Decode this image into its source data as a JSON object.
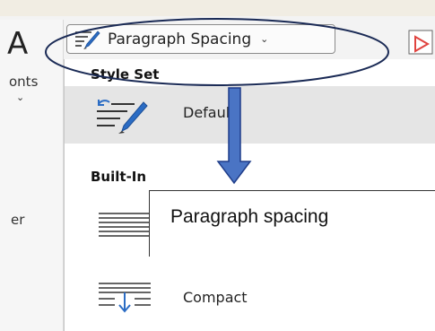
{
  "ribbon": {
    "fonts_label": "onts",
    "left_label": "er"
  },
  "paragraph_button": {
    "label": "Paragraph Spacing"
  },
  "dropdown": {
    "style_set_heading": "Style Set",
    "default_label": "Default",
    "builtin_heading": "Built-In",
    "compact_label": "Compact"
  },
  "callout": {
    "text": "Paragraph spacing"
  },
  "colors": {
    "arrow_fill": "#4a74c4",
    "arrow_stroke": "#1f3d8a",
    "ellipse_stroke": "#1a2a55",
    "brush_blue": "#2b6cc4"
  }
}
